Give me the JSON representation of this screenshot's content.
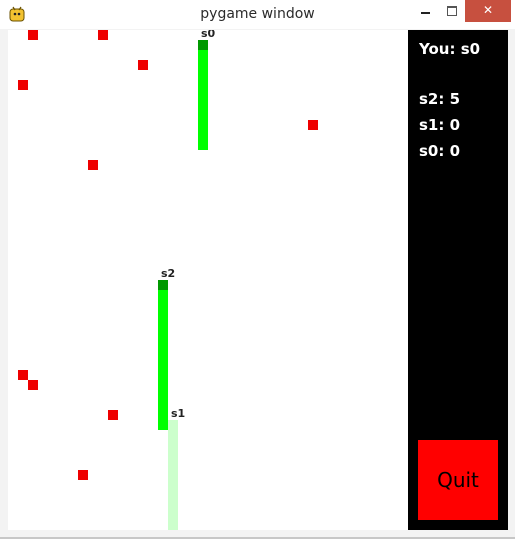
{
  "window": {
    "title": "pygame window",
    "minimize_glyph": "–",
    "close_glyph": "✕"
  },
  "colors": {
    "food": "#ee0000",
    "snake_body": "#00ff00",
    "snake_head": "#009900",
    "snake_faded": "#ccffcc",
    "panel_bg": "#000000",
    "quit_bg": "#ff0000"
  },
  "board": {
    "grid_cells": [
      40,
      50
    ],
    "food": [
      [
        2,
        0
      ],
      [
        9,
        0
      ],
      [
        13,
        3
      ],
      [
        1,
        5
      ],
      [
        30,
        9
      ],
      [
        8,
        13
      ],
      [
        1,
        34
      ],
      [
        2,
        35
      ],
      [
        10,
        38
      ],
      [
        7,
        44
      ]
    ],
    "snakes": [
      {
        "name": "s0",
        "head": [
          19,
          1
        ],
        "body_from": [
          19,
          2
        ],
        "body_to": [
          19,
          11
        ],
        "faded": false
      },
      {
        "name": "s2",
        "head": [
          15,
          25
        ],
        "body_from": [
          15,
          26
        ],
        "body_to": [
          15,
          39
        ],
        "faded": false
      },
      {
        "name": "s1",
        "head": [
          16,
          39
        ],
        "body_from": [
          16,
          40
        ],
        "body_to": [
          16,
          49
        ],
        "faded": true
      }
    ]
  },
  "panel": {
    "you_label": "You: s0",
    "scores": [
      "s2: 5",
      "s1: 0",
      "s0: 0"
    ],
    "quit_label": "Quit"
  }
}
